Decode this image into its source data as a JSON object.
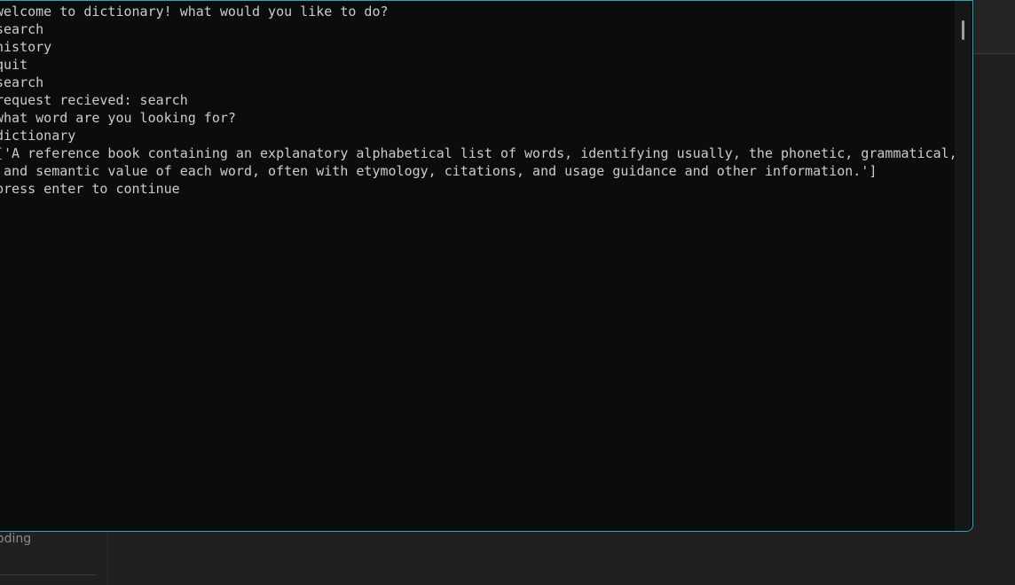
{
  "background_app": {
    "sidebar_label": "oding"
  },
  "terminal": {
    "lines": [
      "welcome to dictionary! what would you like to do?",
      "search",
      "history",
      "quit",
      "search",
      "request recieved: search",
      "what word are you looking for?",
      "dictionary",
      "['A reference book containing an explanatory alphabetical list of words, identifying usually, the phonetic, grammatical,",
      " and semantic value of each word, often with etymology, citations, and usage guidance and other information.']",
      "press enter to continue"
    ],
    "border_color": "#2aa5bd",
    "background_color": "#0c0c0c",
    "text_color": "#cccccc"
  }
}
